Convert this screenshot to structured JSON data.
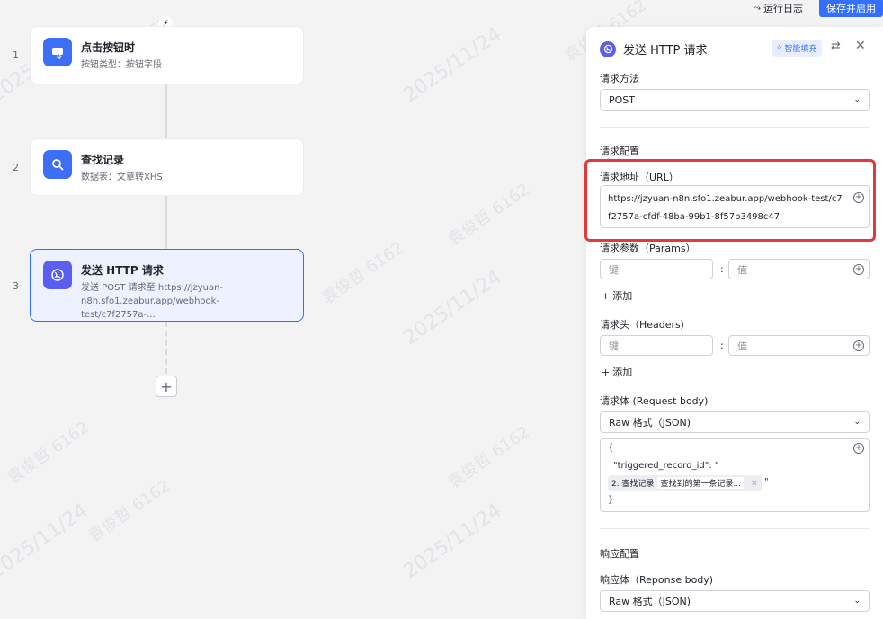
{
  "topbar": {
    "log_label": "运行日志",
    "save_label": "保存并启用"
  },
  "flow": {
    "nodes": [
      {
        "num": "1",
        "title": "点击按钮时",
        "subtitle": "按钮类型：按钮字段"
      },
      {
        "num": "2",
        "title": "查找记录",
        "subtitle": "数据表：文章转XHS"
      },
      {
        "num": "3",
        "title": "发送 HTTP 请求",
        "subtitle_line1": "发送 POST 请求至 https://jzyuan-",
        "subtitle_line2": "n8n.sfo1.zeabur.app/webhook-test/c7f2757a-..."
      }
    ],
    "add_label": "+"
  },
  "panel": {
    "title": "发送 HTTP 请求",
    "smart_fill": "智能填充",
    "method_label": "请求方法",
    "method_value": "POST",
    "config_label": "请求配置",
    "url_label": "请求地址（URL）",
    "url_value": "https://jzyuan-n8n.sfo1.zeabur.app/webhook-test/c7f2757a-cfdf-48ba-99b1-8f57b3498c47",
    "params_label": "请求参数（Params）",
    "params_key_placeholder": "键",
    "params_val_placeholder": "值",
    "params_add": "添加",
    "headers_label": "请求头（Headers）",
    "headers_key_placeholder": "键",
    "headers_val_placeholder": "值",
    "headers_add": "添加",
    "body_label": "请求体 (Request body)",
    "body_format": "Raw 格式（JSON)",
    "body_open": "{",
    "body_key": "\"triggered_record_id\": \"",
    "body_chip_step": "2. 查找记录",
    "body_chip_value": "查找到的第一条记录...",
    "body_quote": "\"",
    "body_close": "}",
    "response_config_label": "响应配置",
    "response_body_label": "响应体（Reponse body)",
    "response_format": "Raw 格式（JSON)"
  },
  "watermark": {
    "name": "袁俊哲 6162",
    "date": "2025/11/24"
  },
  "colors": {
    "accent": "#3370ff",
    "highlight": "#e03a3a",
    "node_icon": "#3d6ef5",
    "http_icon": "#5a5ff0"
  }
}
